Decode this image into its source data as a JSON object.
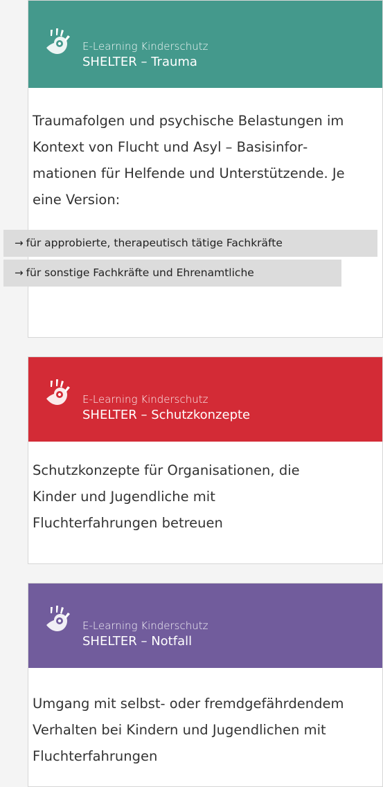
{
  "cards": [
    {
      "color": "#44998c",
      "subtitle": "E-Learning Kinderschutz",
      "title": "SHELTER – Trauma",
      "description": "Traumafolgen und psychische Belastungen im Kontext von Flucht und Asyl – Basisinfor­mationen für Helfende und Unterstützende. Je eine Version:",
      "links": [
        {
          "arrow": "→",
          "label": "für approbierte, therapeutisch tätige Fachkräfte"
        },
        {
          "arrow": "→",
          "label": "für sonstige Fachkräfte und Ehrenamtliche"
        }
      ]
    },
    {
      "color": "#d32b36",
      "subtitle": "E-Learning Kinderschutz",
      "title": "SHELTER – Schutzkonzepte",
      "description": "Schutzkonzepte für Organisationen, die Kinder und Jugendliche mit Fluchterfahrungen betreuen"
    },
    {
      "color": "#715c9c",
      "subtitle": "E-Learning Kinderschutz",
      "title": "SHELTER – Notfall",
      "description": "Umgang mit selbst- oder fremdgefähr­dendem Verhalten bei Kindern und Jugend­lichen mit Fluchterfahrungen"
    }
  ],
  "icon": "hand-logo-icon"
}
